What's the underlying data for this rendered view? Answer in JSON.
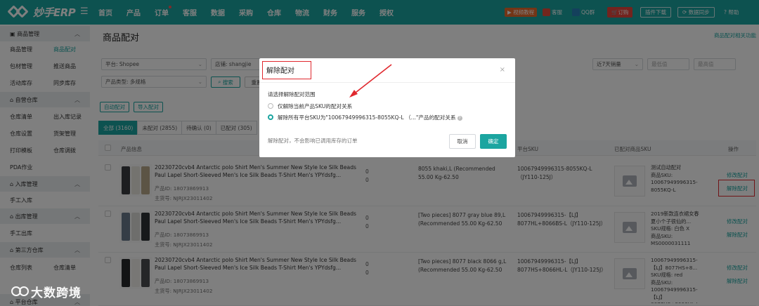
{
  "app": {
    "title": "妙手ERP"
  },
  "nav": [
    "首页",
    "产品",
    "订单",
    "客服",
    "数据",
    "采购",
    "仓库",
    "物流",
    "财务",
    "服务",
    "授权"
  ],
  "topright": {
    "video": "视频教程",
    "kefu": "客服",
    "qq": "QQ群",
    "order": "订购",
    "plugin": "插件下载",
    "sync": "数据同步",
    "help": "帮助"
  },
  "sidebar": {
    "g1": {
      "title": "商品管理",
      "items": [
        "商品管理",
        "商品配对",
        "包材管理",
        "推送商品",
        "活动库存",
        "同步库存"
      ]
    },
    "g2": {
      "title": "自营仓库",
      "items": [
        "仓库清单",
        "出入库记录",
        "仓库设置",
        "货架管理",
        "打印模板",
        "仓库调拨",
        "PDA作业"
      ]
    },
    "g3": {
      "title": "入库管理",
      "items": [
        "手工入库"
      ]
    },
    "g4": {
      "title": "出库管理",
      "items": [
        "手工出库"
      ]
    },
    "g5": {
      "title": "第三方仓库",
      "items": [
        "仓库列表",
        "仓库清单"
      ]
    },
    "g6": {
      "title": "平台仓库"
    }
  },
  "page": {
    "title": "商品配对",
    "link": "商品配对相关功能"
  },
  "filters": {
    "platform": "平台: Shopee",
    "store": "店铺: shangjie",
    "sales": "近7天销量",
    "min": "最低值",
    "max": "最高值",
    "type": "产品类型: 多规格",
    "search": "搜索",
    "reset": "重置"
  },
  "buttons": {
    "auto": "自动配对",
    "import": "导入配对"
  },
  "tabs": [
    "全部 (3160)",
    "未配对 (2855)",
    "待确认 (0)",
    "已配对 (305)"
  ],
  "columns": {
    "product": "产品信息",
    "sku": "平台SKU",
    "matched": "已配对商品SKU",
    "ops": "操作"
  },
  "rows": [
    {
      "title": "20230720cvb4 Antarctic polo Shirt Men's Summer New Style Ice Silk Beads Paul Lapel Short-Sleeved Men's Ice Silk Beads T-Shirt Men's YPYdsfg...",
      "pid": "产品ID: 18073869913",
      "sno": "主货号: NJRJX23011402",
      "z1": "0",
      "z2": "0",
      "spec": "8055 khaki,L (Recommended 55.00 Kg-62.50",
      "psku": "10067949996315-8055KQ-L（JY110-125J）",
      "minfo": "测试自动配对\n商品SKU: 10067949996315-8055KQ-L",
      "edit": "修改配对",
      "unmatch": "解除配对",
      "thumb": [
        "#3a3d41",
        "#e8e6df",
        "#b9a98a"
      ]
    },
    {
      "title": "20230720cvb4 Antarctic polo Shirt Men's Summer New Style Ice Silk Beads Paul Lapel Short-Sleeved Men's Ice Silk Beads T-Shirt Men's YPYdsfg...",
      "pid": "产品ID: 18073869913",
      "sno": "主货号: NJRJX23011402",
      "z1": "0",
      "z2": "0",
      "spec": "[Two pieces] 8077 gray blue 89,L (Recommended 55.00 Kg-62.50",
      "psku": "10067949996315-【LJ】8077HL+8066BS-L（JY110-125J）",
      "minfo": "2019新款连衣裙女春夏小个子很仙的...\nSKU规格: 白色 X\n商品SKU: MS0000031111",
      "edit": "修改配对",
      "unmatch": "解除配对",
      "thumb": [
        "#6b7a8c",
        "#dcdcd8",
        "#2f3236"
      ]
    },
    {
      "title": "20230720cvb4 Antarctic polo Shirt Men's Summer New Style Ice Silk Beads Paul Lapel Short-Sleeved Men's Ice Silk Beads T-Shirt Men's YPYdsfg...",
      "pid": "产品ID: 18073869913",
      "sno": "主货号: NJRJX23011402",
      "z1": "0",
      "z2": "0",
      "spec": "[Two pieces] 8077 black 8066 g,L (Recommended 55.00 Kg-62.50",
      "psku": "10067949996315-【LJ】8077HS+8066HL-L（JY110-125J）",
      "minfo": "10067949996315-【LJ】8077HS+8...\nSKU规格: red\n商品SKU: 10067949996315-【LJ】8077HS+8066HL-L",
      "edit": "修改配对",
      "unmatch": "解除配对",
      "thumb": [
        "#26282b",
        "#f0efea",
        "#4a4c50"
      ]
    }
  ],
  "modal": {
    "title": "解除配对",
    "label": "请选择解除配对范围",
    "opt1": "仅解除当前产品SKU的配对关系",
    "opt2": "解除所有平台SKU为\"10067949996315-8055KQ-L （...\"产品的配对关系",
    "note": "解除配对，不会影响已调用库存的订单",
    "cancel": "取消",
    "ok": "确定"
  },
  "watermark": "大数跨境"
}
